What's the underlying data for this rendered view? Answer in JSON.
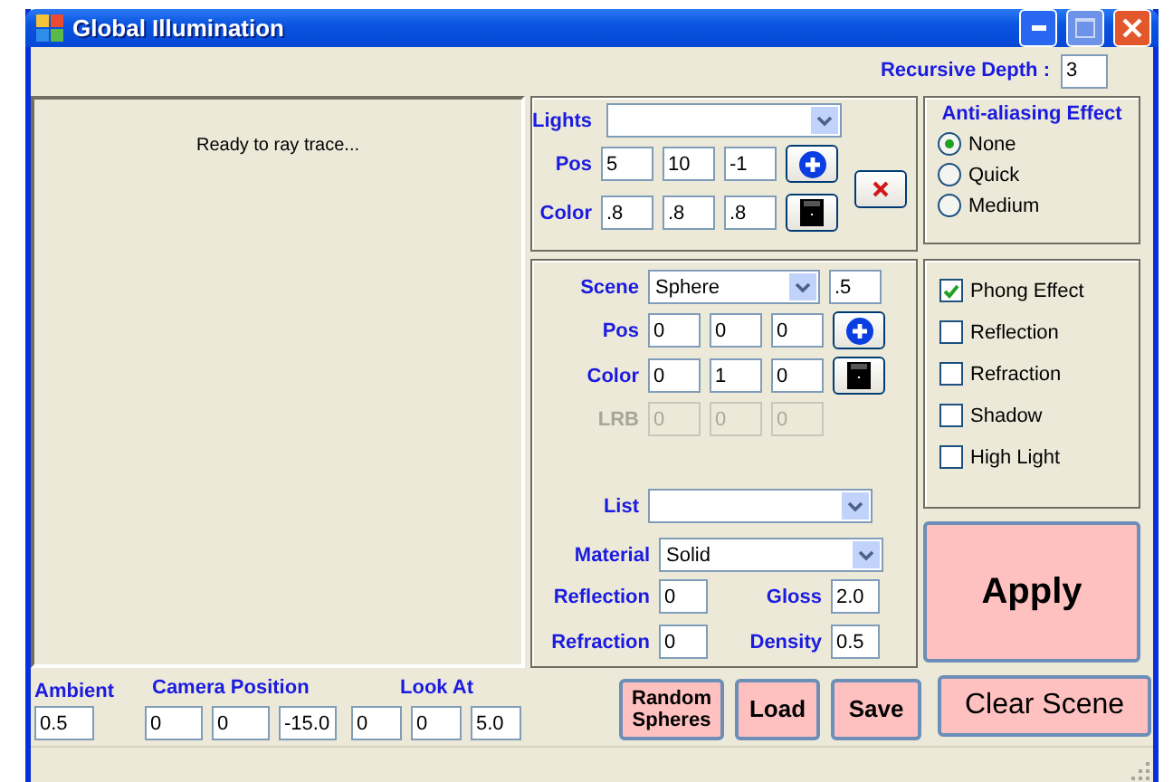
{
  "window": {
    "title": "Global Illumination"
  },
  "recursive_depth": {
    "label": "Recursive Depth :",
    "value": "3"
  },
  "render_view": {
    "status": "Ready to ray trace..."
  },
  "lights": {
    "label": "Lights",
    "pos": {
      "label": "Pos",
      "values": [
        "5",
        "10",
        "-1"
      ]
    },
    "color": {
      "label": "Color",
      "values": [
        ".8",
        ".8",
        ".8"
      ]
    }
  },
  "scene": {
    "label": "Scene",
    "shape": "Sphere",
    "size": ".5",
    "pos": {
      "label": "Pos",
      "values": [
        "0",
        "0",
        "0"
      ]
    },
    "color": {
      "label": "Color",
      "values": [
        "0",
        "1",
        "0"
      ]
    },
    "lrb": {
      "label": "LRB",
      "values": [
        "0",
        "0",
        "0"
      ],
      "disabled": true
    },
    "list": {
      "label": "List"
    },
    "material": {
      "label": "Material",
      "value": "Solid"
    },
    "reflection": {
      "label": "Reflection",
      "value": "0"
    },
    "gloss": {
      "label": "Gloss",
      "value": "2.0"
    },
    "refraction": {
      "label": "Refraction",
      "value": "0"
    },
    "density": {
      "label": "Density",
      "value": "0.5"
    }
  },
  "anti_aliasing": {
    "title": "Anti-aliasing Effect",
    "options": [
      {
        "label": "None",
        "selected": true
      },
      {
        "label": "Quick",
        "selected": false
      },
      {
        "label": "Medium",
        "selected": false
      }
    ]
  },
  "effects": [
    {
      "label": "Phong Effect",
      "checked": true
    },
    {
      "label": "Reflection",
      "checked": false
    },
    {
      "label": "Refraction",
      "checked": false
    },
    {
      "label": "Shadow",
      "checked": false
    },
    {
      "label": "High Light",
      "checked": false
    }
  ],
  "ambient": {
    "label": "Ambient",
    "value": "0.5"
  },
  "camera_position": {
    "label": "Camera Position",
    "values": [
      "0",
      "0",
      "-15.0"
    ]
  },
  "look_at": {
    "label": "Look At",
    "values": [
      "0",
      "0",
      "5.0"
    ]
  },
  "buttons": {
    "apply": "Apply",
    "random": "Random Spheres",
    "load": "Load",
    "save": "Save",
    "clear": "Clear Scene"
  }
}
